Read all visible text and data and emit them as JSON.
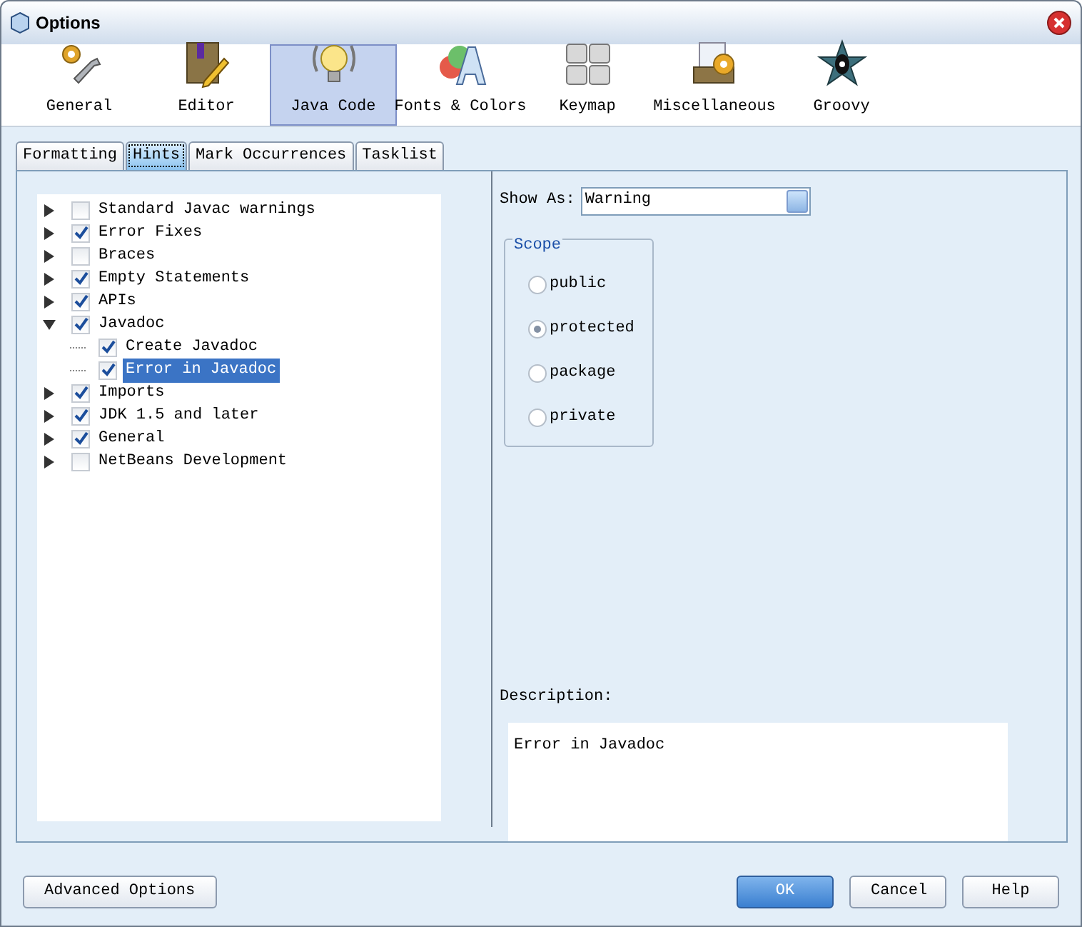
{
  "window": {
    "title": "Options"
  },
  "categories": [
    {
      "label": "General",
      "kind": "gear",
      "selected": false
    },
    {
      "label": "Editor",
      "kind": "book",
      "selected": false
    },
    {
      "label": "Java Code",
      "kind": "bulb",
      "selected": true
    },
    {
      "label": "Fonts & Colors",
      "kind": "fonts",
      "selected": false
    },
    {
      "label": "Keymap",
      "kind": "keys",
      "selected": false
    },
    {
      "label": "Miscellaneous",
      "kind": "misc",
      "selected": false
    },
    {
      "label": "Groovy",
      "kind": "star",
      "selected": false
    }
  ],
  "tabs": [
    {
      "label": "Formatting",
      "selected": false
    },
    {
      "label": "Hints",
      "selected": true
    },
    {
      "label": "Mark Occurrences",
      "selected": false
    },
    {
      "label": "Tasklist",
      "selected": false
    }
  ],
  "tree": [
    {
      "label": "Standard Javac warnings",
      "checked": false,
      "expanded": false,
      "selected": false
    },
    {
      "label": "Error Fixes",
      "checked": true,
      "expanded": false,
      "selected": false
    },
    {
      "label": "Braces",
      "checked": false,
      "expanded": false,
      "selected": false
    },
    {
      "label": "Empty Statements",
      "checked": true,
      "expanded": false,
      "selected": false
    },
    {
      "label": "APIs",
      "checked": true,
      "expanded": false,
      "selected": false
    },
    {
      "label": "Javadoc",
      "checked": true,
      "expanded": true,
      "selected": false,
      "children": [
        {
          "label": "Create Javadoc",
          "checked": true,
          "selected": false
        },
        {
          "label": "Error in Javadoc",
          "checked": true,
          "selected": true
        }
      ]
    },
    {
      "label": "Imports",
      "checked": true,
      "expanded": false,
      "selected": false
    },
    {
      "label": "JDK 1.5 and later",
      "checked": true,
      "expanded": false,
      "selected": false
    },
    {
      "label": "General",
      "checked": true,
      "expanded": false,
      "selected": false
    },
    {
      "label": "NetBeans Development",
      "checked": false,
      "expanded": false,
      "selected": false
    }
  ],
  "show_as": {
    "label": "Show As:",
    "value": "Warning"
  },
  "scope": {
    "title": "Scope",
    "options": [
      {
        "label": "public",
        "selected": false
      },
      {
        "label": "protected",
        "selected": true
      },
      {
        "label": "package",
        "selected": false
      },
      {
        "label": "private",
        "selected": false
      }
    ]
  },
  "description": {
    "label": "Description:",
    "text": "Error in Javadoc"
  },
  "buttons": [
    {
      "label": "Advanced Options",
      "kind": "secondary"
    },
    {
      "label": "OK",
      "kind": "primary"
    },
    {
      "label": "Cancel",
      "kind": "secondary"
    },
    {
      "label": "Help",
      "kind": "secondary"
    }
  ]
}
